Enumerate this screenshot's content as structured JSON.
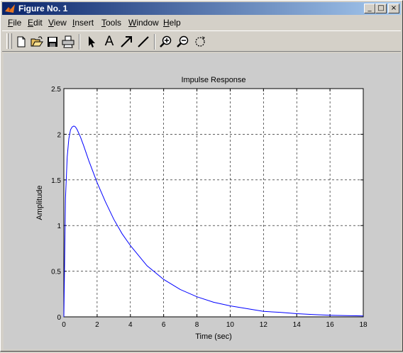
{
  "window": {
    "title": "Figure No. 1",
    "controls": {
      "minimize": "_",
      "maximize": "□",
      "close": "×"
    }
  },
  "menu": {
    "items": [
      {
        "label": "File",
        "key": "F",
        "rest": "ile"
      },
      {
        "label": "Edit",
        "key": "E",
        "rest": "dit"
      },
      {
        "label": "View",
        "key": "V",
        "rest": "iew"
      },
      {
        "label": "Insert",
        "key": "I",
        "rest": "nsert"
      },
      {
        "label": "Tools",
        "key": "T",
        "rest": "ools"
      },
      {
        "label": "Window",
        "key": "W",
        "rest": "indow"
      },
      {
        "label": "Help",
        "key": "H",
        "rest": "elp"
      }
    ]
  },
  "toolbar": {
    "tools": [
      "new-file-icon",
      "open-folder-icon",
      "save-icon",
      "print-icon",
      "select-arrow-icon",
      "insert-text-icon",
      "insert-arrow-icon",
      "insert-line-icon",
      "zoom-in-icon",
      "zoom-out-icon",
      "rotate-3d-icon"
    ],
    "text_tool_label": "A"
  },
  "colors": {
    "title_start": "#0a246a",
    "title_end": "#a6caf0",
    "line": "#0000ff",
    "figure_bg": "#cccccc",
    "axes_bg": "#ffffff"
  },
  "chart_data": {
    "type": "line",
    "title": "Impulse Response",
    "xlabel": "Time (sec)",
    "ylabel": "Amplitude",
    "xlim": [
      0,
      18
    ],
    "ylim": [
      0,
      2.5
    ],
    "xticks": [
      0,
      2,
      4,
      6,
      8,
      10,
      12,
      14,
      16,
      18
    ],
    "yticks": [
      0,
      0.5,
      1,
      1.5,
      2,
      2.5
    ],
    "xtick_labels": [
      "0",
      "2",
      "4",
      "6",
      "8",
      "10",
      "12",
      "14",
      "16",
      "18"
    ],
    "ytick_labels": [
      "0",
      "0.5",
      "1",
      "1.5",
      "2",
      "2.5"
    ],
    "grid": true,
    "series": [
      {
        "x": [
          0,
          0.1,
          0.2,
          0.3,
          0.4,
          0.5,
          0.6,
          0.7,
          0.8,
          1,
          1.2,
          1.5,
          2,
          2.5,
          3,
          3.5,
          4,
          5,
          6,
          7,
          8,
          9,
          10,
          11,
          12,
          13,
          14,
          15,
          16,
          17,
          18
        ],
        "y": [
          0,
          1.3,
          1.75,
          1.95,
          2.05,
          2.08,
          2.09,
          2.08,
          2.05,
          1.97,
          1.87,
          1.71,
          1.47,
          1.26,
          1.07,
          0.91,
          0.78,
          0.56,
          0.41,
          0.3,
          0.22,
          0.16,
          0.12,
          0.09,
          0.06,
          0.05,
          0.035,
          0.025,
          0.018,
          0.013,
          0.01
        ]
      }
    ]
  }
}
